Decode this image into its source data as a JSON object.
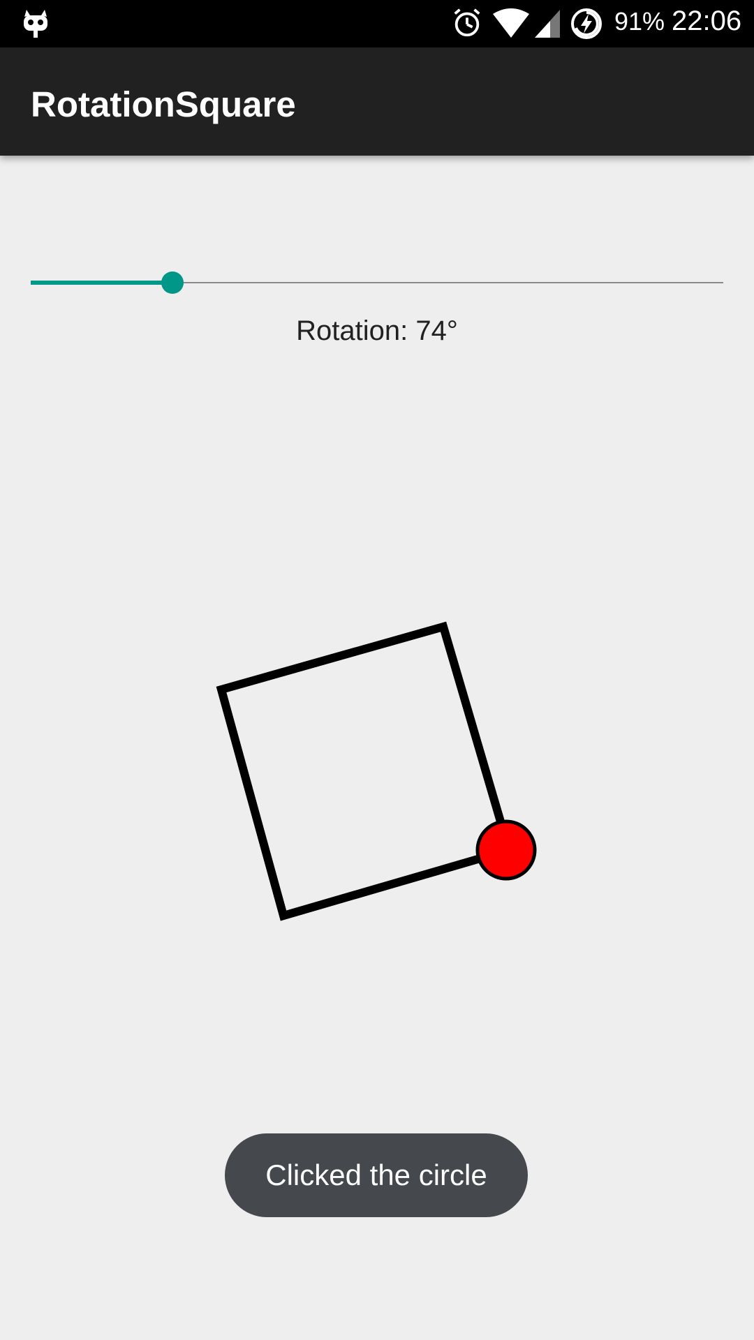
{
  "status_bar": {
    "battery": "91%",
    "time": "22:06",
    "icons": [
      "cyanogen-icon",
      "alarm-icon",
      "wifi-icon",
      "cell-signal-icon",
      "battery-charging-icon"
    ]
  },
  "app_bar": {
    "title": "RotationSquare"
  },
  "seekbar": {
    "fraction": 0.205,
    "color": "#009688"
  },
  "rotation": {
    "label": "Rotation: 74°",
    "degrees": 74
  },
  "canvas": {
    "square_stroke_color": "#000000",
    "circle_fill_color": "#ff0000"
  },
  "toast": {
    "message": "Clicked the circle"
  }
}
